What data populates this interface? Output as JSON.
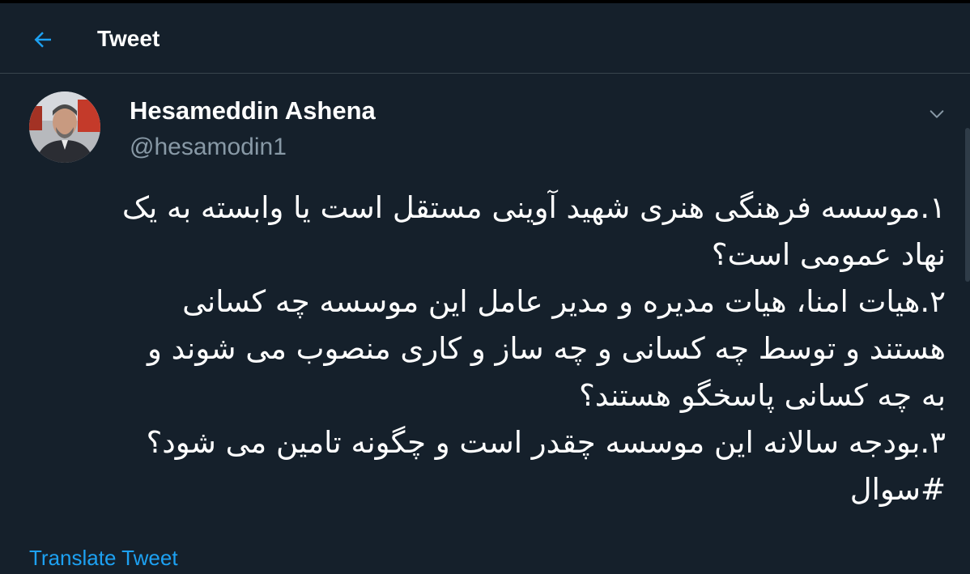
{
  "header": {
    "title": "Tweet",
    "back_icon": "arrow-left-icon"
  },
  "tweet": {
    "author": {
      "name": "Hesameddin Ashena",
      "handle": "@hesamodin1"
    },
    "menu_icon": "chevron-down-icon",
    "lines": [
      "۱.موسسه فرهنگی هنری شهید آوینی مستقل است یا وابسته به یک",
      "نهاد عمومی است؟",
      "۲.هیات امنا، هیات مدیره و مدیر عامل این موسسه چه کسانی",
      "هستند و توسط چه کسانی و چه ساز و کاری منصوب می شوند و",
      "به چه کسانی پاسخگو هستند؟",
      "۳.بودجه سالانه  این موسسه  چقدر است و چگونه تامین می شود؟"
    ],
    "hashtag": "#سوال",
    "translate_label": "Translate Tweet"
  },
  "colors": {
    "background": "#15202b",
    "accent": "#1da1f2",
    "secondary_text": "#8899a6",
    "border": "#38444d"
  }
}
